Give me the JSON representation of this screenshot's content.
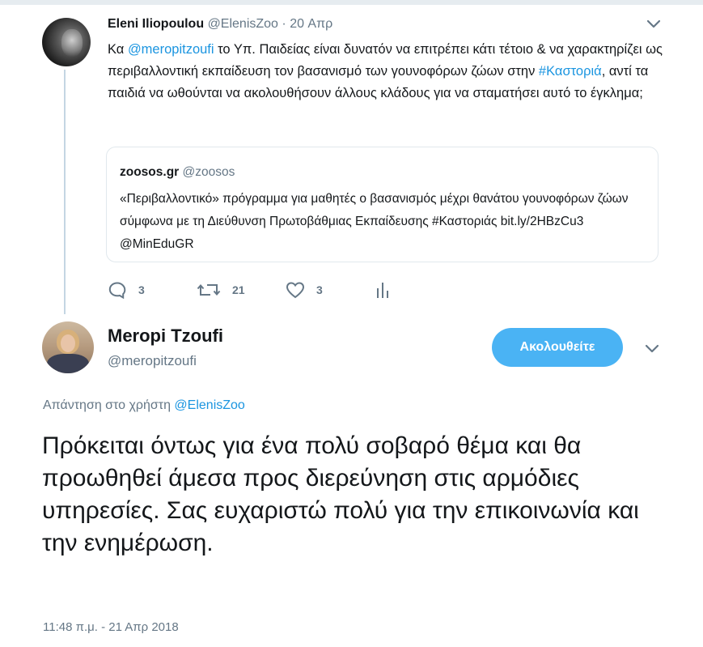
{
  "tweet1": {
    "name": "Eleni Iliopoulou",
    "handle": "@ElenisZoo",
    "separator": "·",
    "date": "20 Απρ",
    "text_1": "Κα ",
    "mention": "@meropitzoufi",
    "text_2": " το Υπ. Παιδείας είναι δυνατόν να επιτρέπει κάτι τέτοιο & να χαρακτηρίζει ως περιβαλλοντική εκπαίδευση τον βασανισμό των γουνοφόρων ζώων στην ",
    "hashtag": "#Καστοριά",
    "text_3": ", αντί τα παιδιά να ωθούνται να ακολουθήσουν άλλους κλάδους για να σταματήσει αυτό το έγκλημα;",
    "quote": {
      "name": "zoosos.gr",
      "handle": "@zoosos",
      "text": "«Περιβαλλοντικό» πρόγραμμα για μαθητές ο βασανισμός μέχρι θανάτου γουνοφόρων ζώων σύμφωνα με τη Διεύθυνση Πρωτοβάθμιας Εκπαίδευσης #Καστοριάς bit.ly/2HBzCu3 @MinEduGR"
    },
    "actions": {
      "replies": "3",
      "retweets": "21",
      "likes": "3"
    }
  },
  "tweet2": {
    "name": "Meropi Tzoufi",
    "handle": "@meropitzoufi",
    "follow_label": "Ακολουθείτε",
    "reply_prefix": "Απάντηση στο χρήστη ",
    "reply_handle": "@ElenisZoo",
    "text": "Πρόκειται όντως για ένα πολύ σοβαρό θέμα και θα προωθηθεί άμεσα προς διερεύνηση στις αρμόδιες υπηρεσίες. Σας ευχαριστώ πολύ για την επικοινωνία και την ενημέρωση.",
    "timestamp": "11:48 π.μ. - 21 Απρ 2018"
  },
  "colors": {
    "link": "#1b95e0",
    "secondary_text": "#657786",
    "follow_button": "#4ab3f4",
    "thread_line": "#c4d6e3"
  },
  "icons": [
    "reply-icon",
    "retweet-icon",
    "like-icon",
    "analytics-icon",
    "chevron-down-icon"
  ]
}
